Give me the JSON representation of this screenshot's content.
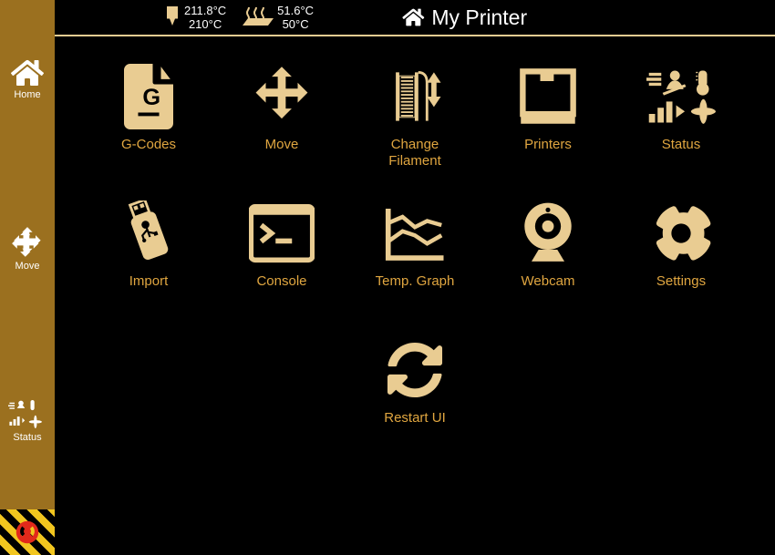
{
  "header": {
    "extruder_actual": "211.8°C",
    "extruder_target": "210°C",
    "bed_actual": "51.6°C",
    "bed_target": "50°C",
    "title": "My Printer"
  },
  "sidebar": {
    "home": "Home",
    "move": "Move",
    "status": "Status"
  },
  "tiles": {
    "gcodes": "G-Codes",
    "move": "Move",
    "change_filament": "Change\nFilament",
    "printers": "Printers",
    "status": "Status",
    "import": "Import",
    "console": "Console",
    "temp_graph": "Temp. Graph",
    "webcam": "Webcam",
    "settings": "Settings",
    "restart_ui": "Restart UI"
  }
}
